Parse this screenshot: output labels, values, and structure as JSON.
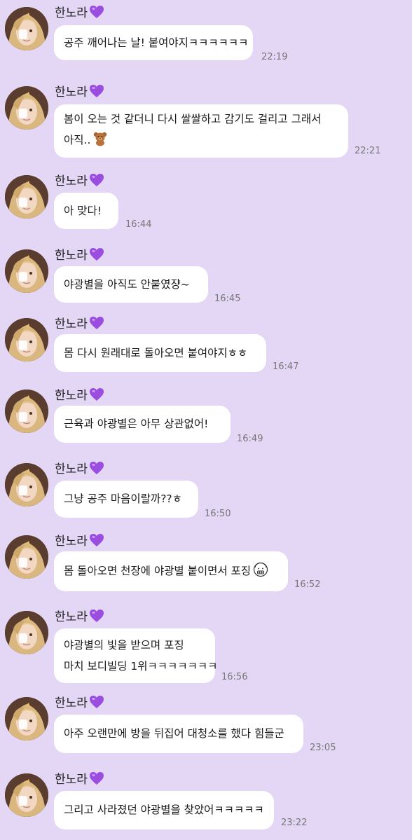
{
  "chat": {
    "background": "#e3d7f5",
    "sender_name": "한노라",
    "messages": [
      {
        "lines": [
          "공주 깨어나는 날! 붙여야지ㅋㅋㅋㅋㅋㅋ"
        ],
        "time": "22:19"
      },
      {
        "lines": [
          "봄이 오는 것 같더니 다시 쌀쌀하고 감기도 걸리고 그래서",
          "아직.."
        ],
        "time": "22:21",
        "emoji": "teddy-bear-icon"
      },
      {
        "lines": [
          "아 맞다!"
        ],
        "time": "16:44"
      },
      {
        "lines": [
          "야광별을 아직도 안붙였쟝~"
        ],
        "time": "16:45"
      },
      {
        "lines": [
          "몸 다시 원래대로 돌아오면 붙여야지ㅎㅎ"
        ],
        "time": "16:47"
      },
      {
        "lines": [
          "근육과 야광별은 아무 상관없어!"
        ],
        "time": "16:49"
      },
      {
        "lines": [
          "그냥 공주 마음이랄까??ㅎ"
        ],
        "time": "16:50"
      },
      {
        "lines": [
          "몸 돌아오면 천장에 야광별 붙이면서 포징"
        ],
        "time": "16:52",
        "emoji": "grimacing-face-icon"
      },
      {
        "lines": [
          "야광별의 빛을 받으며 포징",
          "마치 보디빌딩 1위ㅋㅋㅋㅋㅋㅋㅋ"
        ],
        "time": "16:56"
      },
      {
        "lines": [
          "아주 오랜만에 방을 뒤집어 대청소를 했다 힘들군"
        ],
        "time": "23:05"
      },
      {
        "lines": [
          "그리고 사라졌던 야광별을 찾았어ㅋㅋㅋㅋㅋ"
        ],
        "time": "23:22"
      }
    ]
  }
}
